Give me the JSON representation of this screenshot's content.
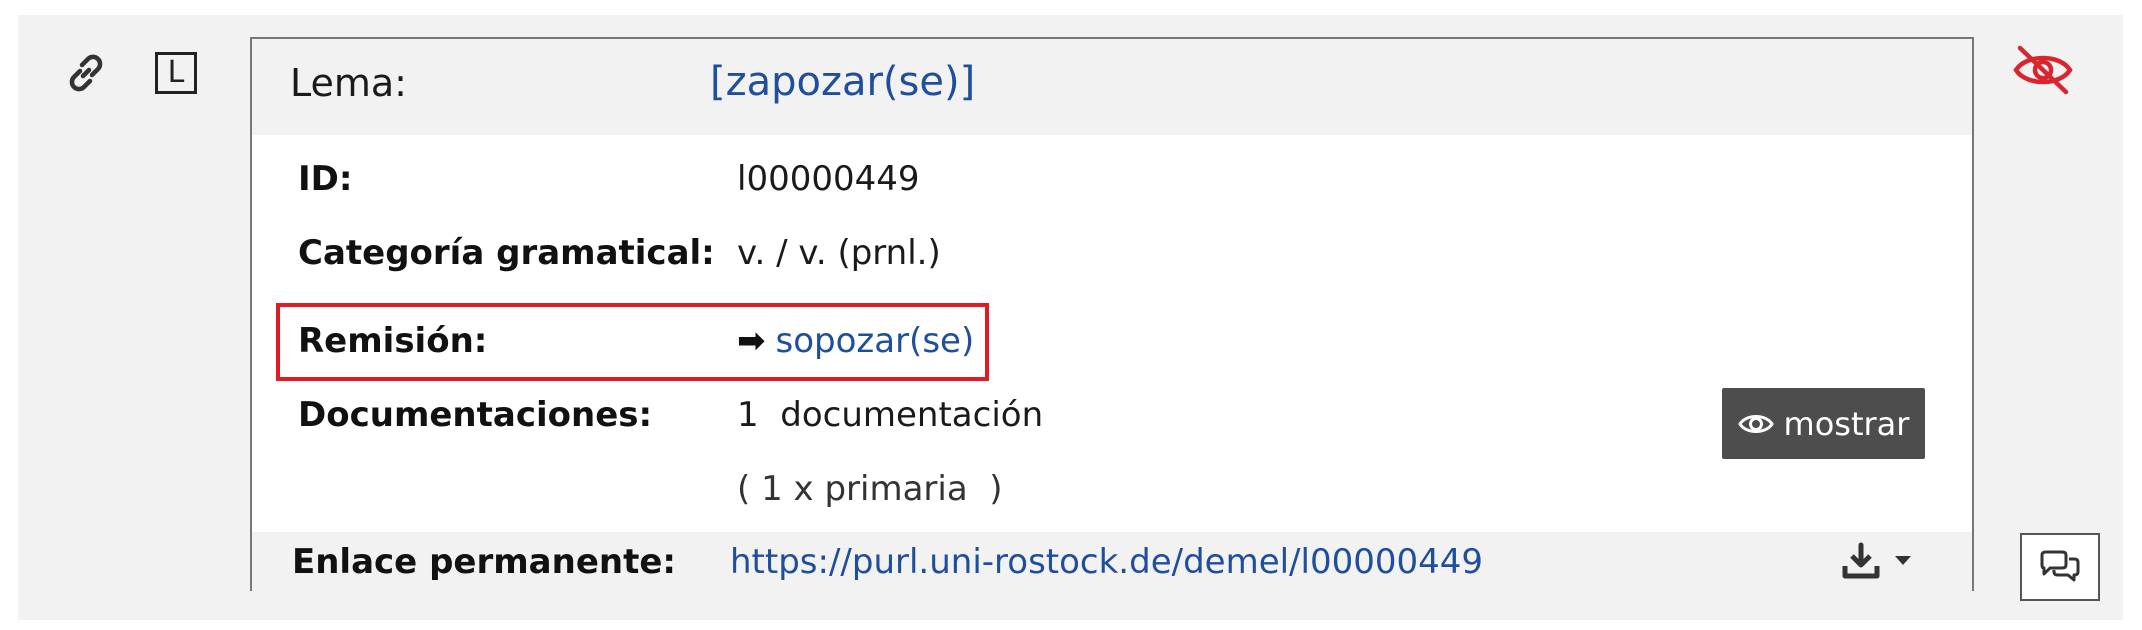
{
  "icons": {
    "link": "link-icon",
    "letter_box": "L",
    "hide": "eye-slash-icon",
    "eye": "eye-icon",
    "download": "download-icon",
    "caret": "caret-down-icon",
    "comments": "comments-icon"
  },
  "colors": {
    "link": "#1f4e9c",
    "highlight": "#e01b24",
    "hide_icon": "#d9262e",
    "button_bg": "#4d4d4d"
  },
  "entry": {
    "lema_label": "Lema:",
    "lema_value": "[zapozar(se)]",
    "id_label": "ID:",
    "id_value": "l00000449",
    "categoria_label": "Categoría gramatical:",
    "categoria_value": "v. / v. (prnl.)",
    "remision_label": "Remisión:",
    "remision_arrow": "➡",
    "remision_value": "sopozar(se)",
    "documentaciones_label": "Documentaciones:",
    "documentaciones_value": "1  documentación",
    "documentaciones_detail": "( 1 x primaria  )",
    "show_button_label": "mostrar",
    "permalink_label": "Enlace permanente:",
    "permalink_value": "https://purl.uni-rostock.de/demel/l00000449"
  }
}
